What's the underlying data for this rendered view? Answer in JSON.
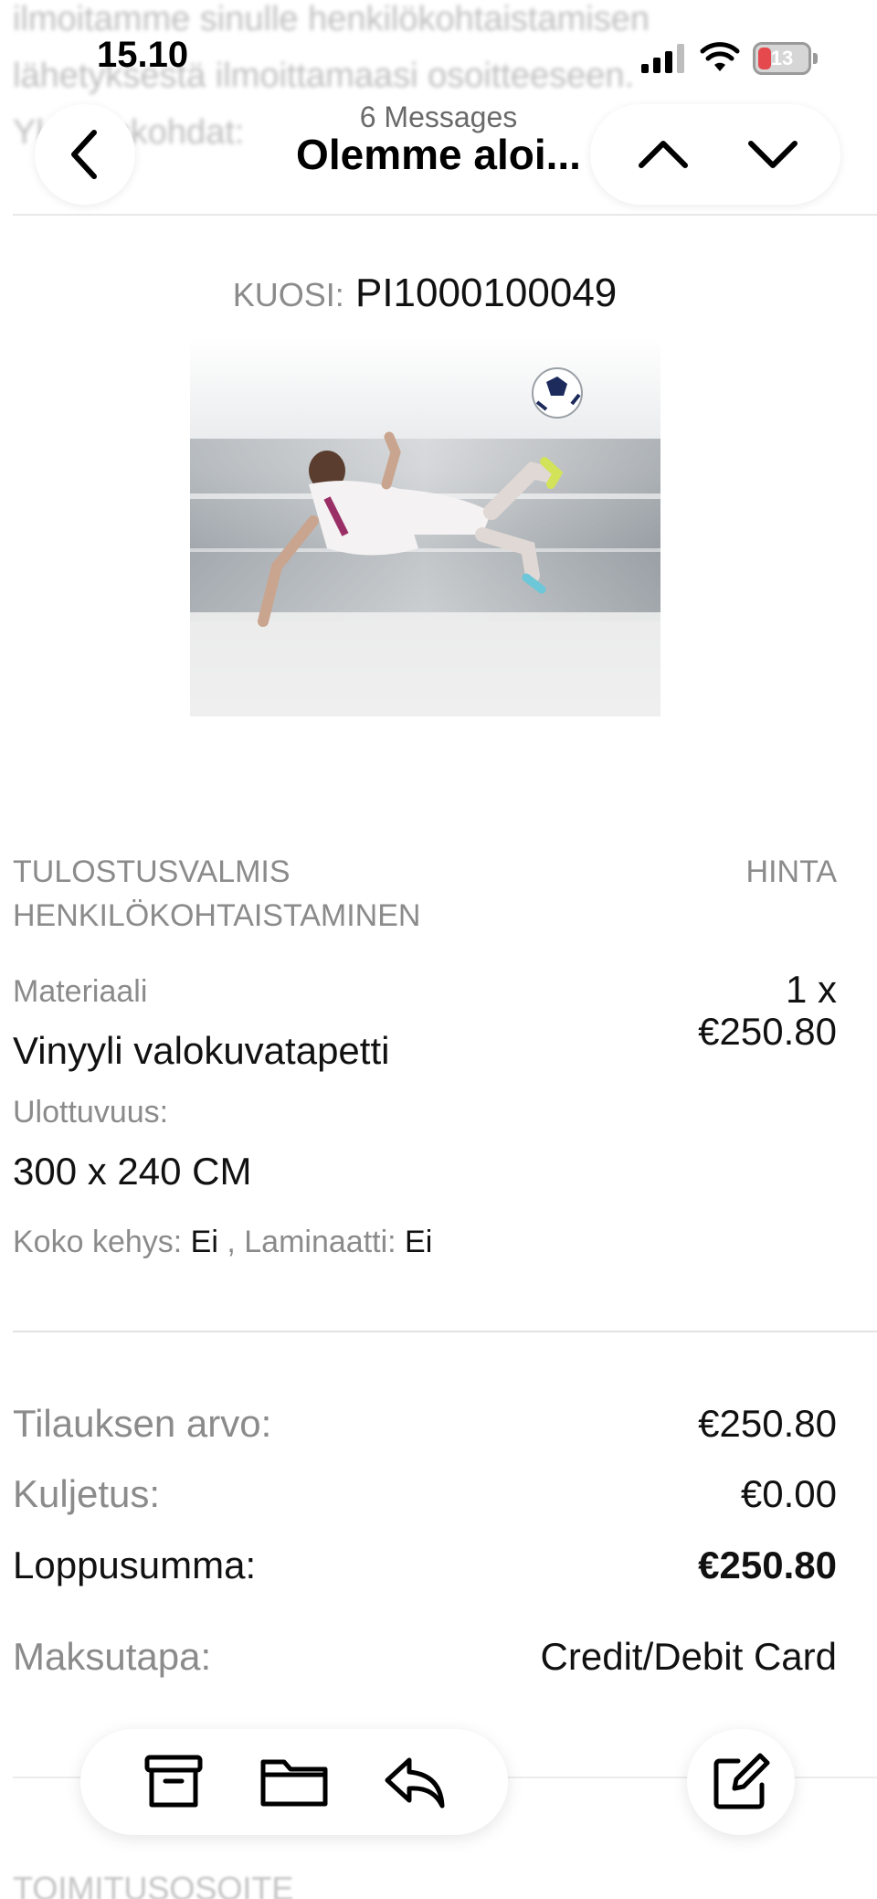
{
  "background_blur_text": [
    "ilmoitamme sinulle henkilökohtaistamisen",
    "lähetyksestä ilmoittamaasi osoitteeseen.",
    "Yksityiskohdat:"
  ],
  "status_bar": {
    "time": "15.10",
    "battery_level": "13",
    "icons": [
      "cellular-signal-icon",
      "wifi-icon",
      "battery-icon"
    ]
  },
  "nav": {
    "message_count": "6 Messages",
    "title": "Olemme aloi...",
    "icons": [
      "chevron-left-icon",
      "chevron-up-icon",
      "chevron-down-icon"
    ]
  },
  "product": {
    "pattern_label": "KUOSI:",
    "pattern_code": "PI1000100049"
  },
  "item": {
    "header_left_line1": "TULOSTUSVALMIS",
    "header_left_line2": "HENKILÖKOHTAISTAMINEN",
    "header_right": "HINTA",
    "material_label": "Materiaali",
    "material_value": "Vinyyli valokuvatapetti",
    "dimension_label": "Ulottuvuus:",
    "dimension_value": "300 x 240 CM",
    "quantity": "1 x",
    "unit_price": "€250.80",
    "frame_label": "Koko kehys:",
    "frame_value": "Ei",
    "separator": ",",
    "laminate_label": "Laminaatti:",
    "laminate_value": "Ei"
  },
  "totals": {
    "order_value_label": "Tilauksen arvo:",
    "order_value": "€250.80",
    "shipping_label": "Kuljetus:",
    "shipping_value": "€0.00",
    "total_label": "Loppusumma:",
    "total_value": "€250.80",
    "payment_label": "Maksutapa:",
    "payment_value": "Credit/Debit Card"
  },
  "next_section_heading": "TOIMITUSOSOITE",
  "toolbar": {
    "icons": [
      "archive-icon",
      "folder-icon",
      "reply-icon",
      "compose-icon"
    ]
  },
  "colors": {
    "label_gray": "#8b8b8b",
    "text": "#111111",
    "battery_red": "#e5484d"
  }
}
